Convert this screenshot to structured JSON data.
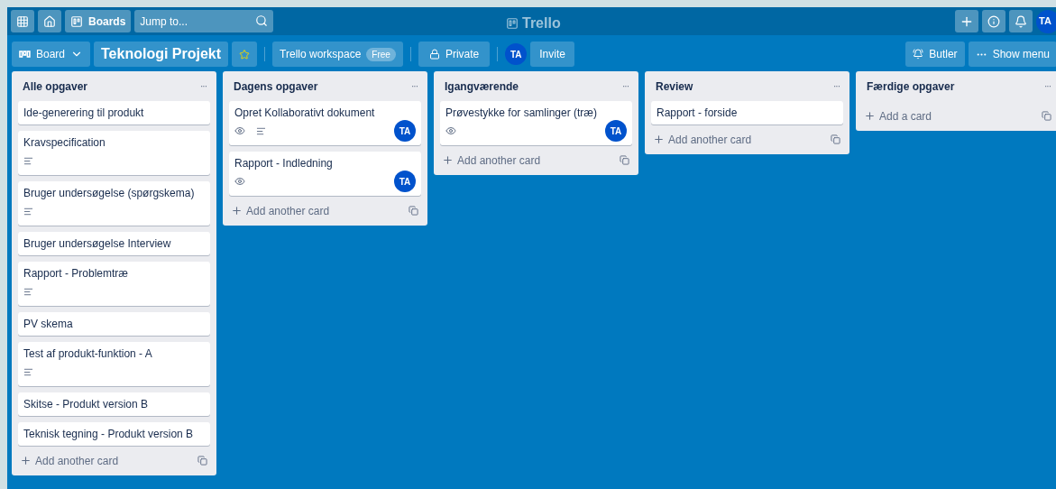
{
  "header": {
    "boards_label": "Boards",
    "search_placeholder": "Jump to...",
    "logo": "Trello",
    "avatar": "TA"
  },
  "board_bar": {
    "view": "Board",
    "title": "Teknologi Projekt",
    "starred": true,
    "workspace": "Trello workspace",
    "workspace_badge": "Free",
    "visibility": "Private",
    "member": "TA",
    "invite": "Invite",
    "butler": "Butler",
    "menu": "Show menu"
  },
  "lists": [
    {
      "title": "Alle opgaver",
      "menu": "···",
      "add": "Add another card",
      "cards": [
        {
          "title": "Ide-generering til produkt"
        },
        {
          "title": "Kravspecification",
          "badges": [
            {
              "kind": "description"
            }
          ]
        },
        {
          "title": "Bruger undersøgelse (spørgskema)",
          "badges": [
            {
              "kind": "description"
            }
          ]
        },
        {
          "title": "Bruger undersøgelse Interview"
        },
        {
          "title": "Rapport - Problemtræ",
          "badges": [
            {
              "kind": "description"
            }
          ]
        },
        {
          "title": "PV skema"
        },
        {
          "title": "Test af produkt-funktion - A",
          "badges": [
            {
              "kind": "description"
            }
          ]
        },
        {
          "title": "Skitse - Produkt version B"
        },
        {
          "title": "Teknisk tegning - Produkt version B"
        }
      ]
    },
    {
      "title": "Dagens opgaver",
      "menu": "···",
      "add": "Add another card",
      "cards": [
        {
          "title": "Opret Kollaborativt dokument",
          "badges": [
            {
              "kind": "watch"
            },
            {
              "kind": "description"
            }
          ],
          "member": "TA"
        },
        {
          "title": "Rapport - Indledning",
          "badges": [
            {
              "kind": "watch"
            }
          ],
          "member": "TA"
        }
      ]
    },
    {
      "title": "Igangværende",
      "menu": "···",
      "add": "Add another card",
      "cards": [
        {
          "title": "Prøvestykke for samlinger (træ)",
          "badges": [
            {
              "kind": "watch"
            }
          ],
          "member": "TA"
        }
      ]
    },
    {
      "title": "Review",
      "menu": "···",
      "add": "Add another card",
      "cards": [
        {
          "title": "Rapport - forside"
        }
      ]
    },
    {
      "title": "Færdige opgaver",
      "menu": "···",
      "add": "Add a card"
    }
  ]
}
